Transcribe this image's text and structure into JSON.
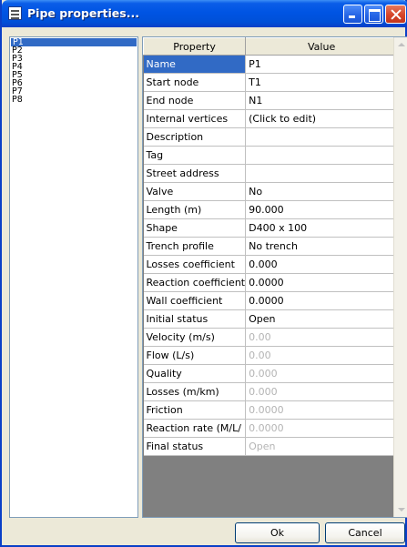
{
  "window": {
    "title": "Pipe properties..."
  },
  "pipes": [
    {
      "label": "P1",
      "selected": true
    },
    {
      "label": "P2",
      "selected": false
    },
    {
      "label": "P3",
      "selected": false
    },
    {
      "label": "P4",
      "selected": false
    },
    {
      "label": "P5",
      "selected": false
    },
    {
      "label": "P6",
      "selected": false
    },
    {
      "label": "P7",
      "selected": false
    },
    {
      "label": "P8",
      "selected": false
    }
  ],
  "grid": {
    "columns": [
      "Property",
      "Value"
    ],
    "rows": [
      {
        "property": "Name",
        "value": "P1",
        "selected": true,
        "readonly": false
      },
      {
        "property": "Start node",
        "value": "T1",
        "selected": false,
        "readonly": false
      },
      {
        "property": "End node",
        "value": "N1",
        "selected": false,
        "readonly": false
      },
      {
        "property": "Internal vertices",
        "value": "(Click to edit)",
        "selected": false,
        "readonly": false
      },
      {
        "property": "Description",
        "value": "",
        "selected": false,
        "readonly": false
      },
      {
        "property": "Tag",
        "value": "",
        "selected": false,
        "readonly": false
      },
      {
        "property": "Street address",
        "value": "",
        "selected": false,
        "readonly": false
      },
      {
        "property": "Valve",
        "value": "No",
        "selected": false,
        "readonly": false
      },
      {
        "property": "Length (m)",
        "value": "90.000",
        "selected": false,
        "readonly": false
      },
      {
        "property": "Shape",
        "value": "D400 x 100",
        "selected": false,
        "readonly": false
      },
      {
        "property": "Trench profile",
        "value": "No trench",
        "selected": false,
        "readonly": false
      },
      {
        "property": "Losses coefficient",
        "value": "0.000",
        "selected": false,
        "readonly": false
      },
      {
        "property": "Reaction coefficient",
        "value": "0.0000",
        "selected": false,
        "readonly": false
      },
      {
        "property": "Wall coefficient",
        "value": "0.0000",
        "selected": false,
        "readonly": false
      },
      {
        "property": "Initial status",
        "value": "Open",
        "selected": false,
        "readonly": false
      },
      {
        "property": "Velocity (m/s)",
        "value": "0.00",
        "selected": false,
        "readonly": true
      },
      {
        "property": "Flow (L/s)",
        "value": "0.00",
        "selected": false,
        "readonly": true
      },
      {
        "property": "Quality",
        "value": "0.000",
        "selected": false,
        "readonly": true
      },
      {
        "property": "Losses (m/km)",
        "value": "0.000",
        "selected": false,
        "readonly": true
      },
      {
        "property": "Friction",
        "value": "0.0000",
        "selected": false,
        "readonly": true
      },
      {
        "property": "Reaction rate (M/L/",
        "value": "0.0000",
        "selected": false,
        "readonly": true
      },
      {
        "property": "Final status",
        "value": "Open",
        "selected": false,
        "readonly": true
      }
    ]
  },
  "buttons": {
    "ok": "Ok",
    "cancel": "Cancel"
  }
}
